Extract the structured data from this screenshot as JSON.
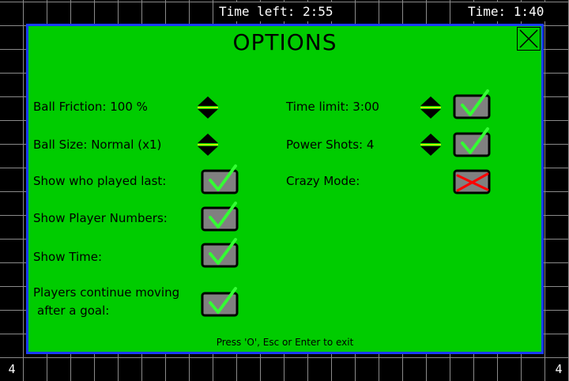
{
  "hud": {
    "time_left": "Time left: 2:55",
    "time": "Time: 1:40",
    "score_left": "4",
    "score_right": "4"
  },
  "options": {
    "title": "OPTIONS",
    "hint": "Press 'O', Esc or Enter to exit",
    "ball_friction": "Ball Friction:  100 %",
    "ball_size": "Ball Size: Normal (x1)",
    "show_who_played_last": "Show who played last:",
    "show_player_numbers": "Show Player Numbers:",
    "show_time": "Show Time:",
    "players_continue_line1": "Players continue moving",
    "players_continue_line2": "after a goal:",
    "time_limit": "Time limit:  3:00",
    "power_shots": "Power Shots:  4",
    "crazy_mode": "Crazy Mode:"
  },
  "toggles": {
    "show_who_played_last": true,
    "show_player_numbers": true,
    "show_time": true,
    "players_continue_moving": true,
    "time_limit": true,
    "power_shots": true,
    "crazy_mode": false
  },
  "colors": {
    "panel_bg": "#00cc00",
    "panel_border": "#1a3cff",
    "check": "#33ff33",
    "cross": "#ff0000",
    "arrow_line": "#ffff00"
  },
  "icons": {
    "close": "close-x-icon",
    "arrows": "up-down-arrows-icon",
    "checked": "checkmark-icon",
    "unchecked": "cross-icon"
  }
}
